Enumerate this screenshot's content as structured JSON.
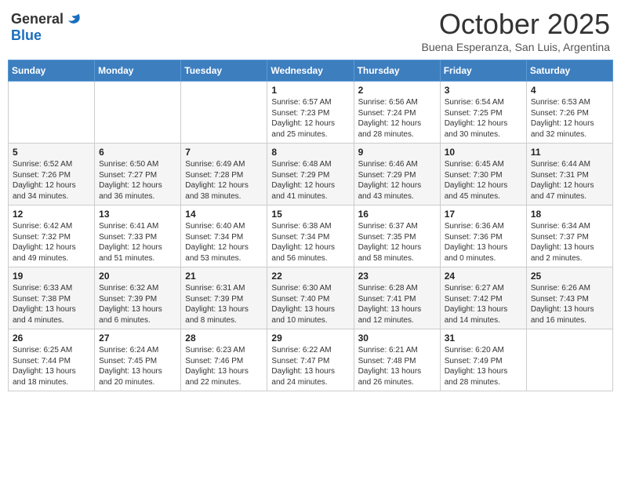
{
  "logo": {
    "general": "General",
    "blue": "Blue"
  },
  "title": "October 2025",
  "subtitle": "Buena Esperanza, San Luis, Argentina",
  "days_of_week": [
    "Sunday",
    "Monday",
    "Tuesday",
    "Wednesday",
    "Thursday",
    "Friday",
    "Saturday"
  ],
  "weeks": [
    [
      {
        "day": "",
        "sunrise": "",
        "sunset": "",
        "daylight": ""
      },
      {
        "day": "",
        "sunrise": "",
        "sunset": "",
        "daylight": ""
      },
      {
        "day": "",
        "sunrise": "",
        "sunset": "",
        "daylight": ""
      },
      {
        "day": "1",
        "sunrise": "Sunrise: 6:57 AM",
        "sunset": "Sunset: 7:23 PM",
        "daylight": "Daylight: 12 hours and 25 minutes."
      },
      {
        "day": "2",
        "sunrise": "Sunrise: 6:56 AM",
        "sunset": "Sunset: 7:24 PM",
        "daylight": "Daylight: 12 hours and 28 minutes."
      },
      {
        "day": "3",
        "sunrise": "Sunrise: 6:54 AM",
        "sunset": "Sunset: 7:25 PM",
        "daylight": "Daylight: 12 hours and 30 minutes."
      },
      {
        "day": "4",
        "sunrise": "Sunrise: 6:53 AM",
        "sunset": "Sunset: 7:26 PM",
        "daylight": "Daylight: 12 hours and 32 minutes."
      }
    ],
    [
      {
        "day": "5",
        "sunrise": "Sunrise: 6:52 AM",
        "sunset": "Sunset: 7:26 PM",
        "daylight": "Daylight: 12 hours and 34 minutes."
      },
      {
        "day": "6",
        "sunrise": "Sunrise: 6:50 AM",
        "sunset": "Sunset: 7:27 PM",
        "daylight": "Daylight: 12 hours and 36 minutes."
      },
      {
        "day": "7",
        "sunrise": "Sunrise: 6:49 AM",
        "sunset": "Sunset: 7:28 PM",
        "daylight": "Daylight: 12 hours and 38 minutes."
      },
      {
        "day": "8",
        "sunrise": "Sunrise: 6:48 AM",
        "sunset": "Sunset: 7:29 PM",
        "daylight": "Daylight: 12 hours and 41 minutes."
      },
      {
        "day": "9",
        "sunrise": "Sunrise: 6:46 AM",
        "sunset": "Sunset: 7:29 PM",
        "daylight": "Daylight: 12 hours and 43 minutes."
      },
      {
        "day": "10",
        "sunrise": "Sunrise: 6:45 AM",
        "sunset": "Sunset: 7:30 PM",
        "daylight": "Daylight: 12 hours and 45 minutes."
      },
      {
        "day": "11",
        "sunrise": "Sunrise: 6:44 AM",
        "sunset": "Sunset: 7:31 PM",
        "daylight": "Daylight: 12 hours and 47 minutes."
      }
    ],
    [
      {
        "day": "12",
        "sunrise": "Sunrise: 6:42 AM",
        "sunset": "Sunset: 7:32 PM",
        "daylight": "Daylight: 12 hours and 49 minutes."
      },
      {
        "day": "13",
        "sunrise": "Sunrise: 6:41 AM",
        "sunset": "Sunset: 7:33 PM",
        "daylight": "Daylight: 12 hours and 51 minutes."
      },
      {
        "day": "14",
        "sunrise": "Sunrise: 6:40 AM",
        "sunset": "Sunset: 7:34 PM",
        "daylight": "Daylight: 12 hours and 53 minutes."
      },
      {
        "day": "15",
        "sunrise": "Sunrise: 6:38 AM",
        "sunset": "Sunset: 7:34 PM",
        "daylight": "Daylight: 12 hours and 56 minutes."
      },
      {
        "day": "16",
        "sunrise": "Sunrise: 6:37 AM",
        "sunset": "Sunset: 7:35 PM",
        "daylight": "Daylight: 12 hours and 58 minutes."
      },
      {
        "day": "17",
        "sunrise": "Sunrise: 6:36 AM",
        "sunset": "Sunset: 7:36 PM",
        "daylight": "Daylight: 13 hours and 0 minutes."
      },
      {
        "day": "18",
        "sunrise": "Sunrise: 6:34 AM",
        "sunset": "Sunset: 7:37 PM",
        "daylight": "Daylight: 13 hours and 2 minutes."
      }
    ],
    [
      {
        "day": "19",
        "sunrise": "Sunrise: 6:33 AM",
        "sunset": "Sunset: 7:38 PM",
        "daylight": "Daylight: 13 hours and 4 minutes."
      },
      {
        "day": "20",
        "sunrise": "Sunrise: 6:32 AM",
        "sunset": "Sunset: 7:39 PM",
        "daylight": "Daylight: 13 hours and 6 minutes."
      },
      {
        "day": "21",
        "sunrise": "Sunrise: 6:31 AM",
        "sunset": "Sunset: 7:39 PM",
        "daylight": "Daylight: 13 hours and 8 minutes."
      },
      {
        "day": "22",
        "sunrise": "Sunrise: 6:30 AM",
        "sunset": "Sunset: 7:40 PM",
        "daylight": "Daylight: 13 hours and 10 minutes."
      },
      {
        "day": "23",
        "sunrise": "Sunrise: 6:28 AM",
        "sunset": "Sunset: 7:41 PM",
        "daylight": "Daylight: 13 hours and 12 minutes."
      },
      {
        "day": "24",
        "sunrise": "Sunrise: 6:27 AM",
        "sunset": "Sunset: 7:42 PM",
        "daylight": "Daylight: 13 hours and 14 minutes."
      },
      {
        "day": "25",
        "sunrise": "Sunrise: 6:26 AM",
        "sunset": "Sunset: 7:43 PM",
        "daylight": "Daylight: 13 hours and 16 minutes."
      }
    ],
    [
      {
        "day": "26",
        "sunrise": "Sunrise: 6:25 AM",
        "sunset": "Sunset: 7:44 PM",
        "daylight": "Daylight: 13 hours and 18 minutes."
      },
      {
        "day": "27",
        "sunrise": "Sunrise: 6:24 AM",
        "sunset": "Sunset: 7:45 PM",
        "daylight": "Daylight: 13 hours and 20 minutes."
      },
      {
        "day": "28",
        "sunrise": "Sunrise: 6:23 AM",
        "sunset": "Sunset: 7:46 PM",
        "daylight": "Daylight: 13 hours and 22 minutes."
      },
      {
        "day": "29",
        "sunrise": "Sunrise: 6:22 AM",
        "sunset": "Sunset: 7:47 PM",
        "daylight": "Daylight: 13 hours and 24 minutes."
      },
      {
        "day": "30",
        "sunrise": "Sunrise: 6:21 AM",
        "sunset": "Sunset: 7:48 PM",
        "daylight": "Daylight: 13 hours and 26 minutes."
      },
      {
        "day": "31",
        "sunrise": "Sunrise: 6:20 AM",
        "sunset": "Sunset: 7:49 PM",
        "daylight": "Daylight: 13 hours and 28 minutes."
      },
      {
        "day": "",
        "sunrise": "",
        "sunset": "",
        "daylight": ""
      }
    ]
  ]
}
